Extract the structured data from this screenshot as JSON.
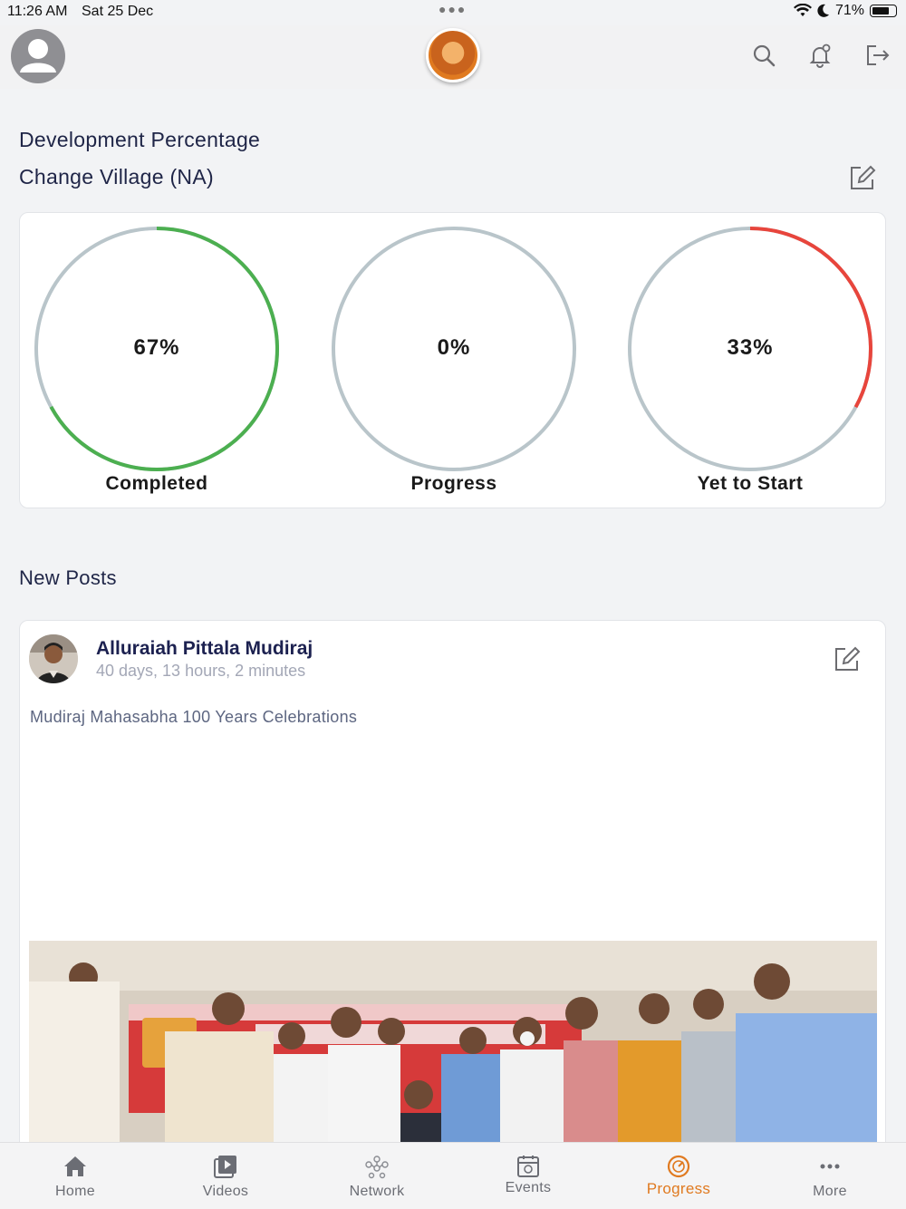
{
  "status_bar": {
    "time": "11:26 AM",
    "date": "Sat 25 Dec",
    "battery": "71%",
    "battery_level": 0.71
  },
  "header": {
    "icons": [
      "user-avatar-icon",
      "brand-logo",
      "search-icon",
      "notification-bell-icon",
      "logout-icon"
    ]
  },
  "development": {
    "title": "Development Percentage",
    "subtitle": "Change Village (NA)",
    "gauges": [
      {
        "value_text": "67%",
        "label": "Completed",
        "percent": 67,
        "color": "#4caf50"
      },
      {
        "value_text": "0%",
        "label": "Progress",
        "percent": 0,
        "color": "#ff9800"
      },
      {
        "value_text": "33%",
        "label": "Yet to Start",
        "percent": 33,
        "color": "#e8453c"
      }
    ],
    "track_color": "#b9c5ca"
  },
  "posts": {
    "title": "New Posts",
    "items": [
      {
        "author": "Alluraiah Pittala Mudiraj",
        "time": "40 days, 13 hours, 2 minutes",
        "text": "Mudiraj Mahasabha 100 Years Celebrations"
      }
    ]
  },
  "tabs": [
    {
      "label": "Home",
      "icon": "home-icon",
      "active": false
    },
    {
      "label": "Videos",
      "icon": "video-icon",
      "active": false
    },
    {
      "label": "Network",
      "icon": "network-icon",
      "active": false
    },
    {
      "label": "Events",
      "icon": "calendar-icon",
      "active": false
    },
    {
      "label": "Progress",
      "icon": "progress-icon",
      "active": true
    },
    {
      "label": "More",
      "icon": "more-icon",
      "active": false
    }
  ],
  "colors": {
    "accent": "#e07a20",
    "heading": "#1f2547",
    "tab_inactive": "#6b6d74"
  }
}
